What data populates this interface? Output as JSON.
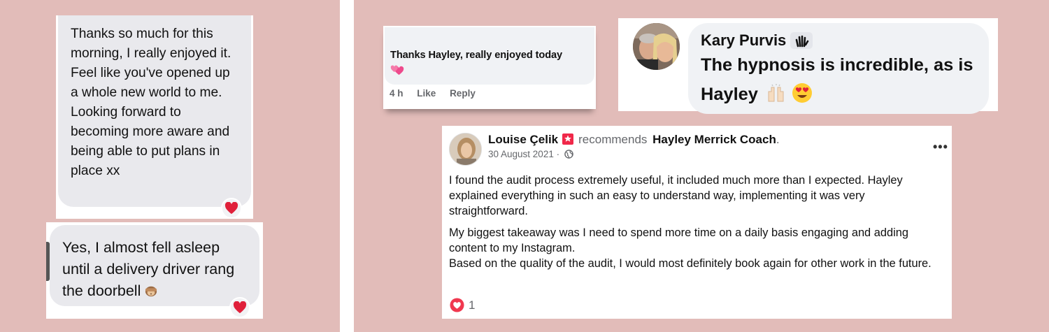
{
  "imessage_1": {
    "text": "Thanks so much for this morning, I really enjoyed it. Feel like you've opened up a whole new world to me. Looking forward to becoming more aware and being able to put plans in place xx",
    "reaction_icon": "heart-icon"
  },
  "imessage_2": {
    "text": "Yes, I almost fell asleep until a delivery driver rang the doorbell",
    "emoji_icon": "see-no-evil-monkey-icon",
    "reaction_icon": "heart-icon"
  },
  "fb_comment": {
    "text": "Thanks Hayley, really enjoyed today",
    "emoji_icon": "two-hearts-icon",
    "time": "4 h",
    "like_label": "Like",
    "reply_label": "Reply"
  },
  "kary_comment": {
    "name": "Kary Purvis",
    "badge_icon": "waving-hand-icon",
    "line1": "The hypnosis is incredible, as is",
    "line2": "Hayley",
    "emoji_icons": [
      "raising-hands-icon",
      "heart-eyes-icon"
    ]
  },
  "review": {
    "author": "Louise Çelik",
    "author_badge_icon": "recommend-flag-icon",
    "verb": "recommends",
    "page_name": "Hayley Merrick Coach",
    "end_punct": ".",
    "date": "30 August 2021 ·",
    "audience_icon": "globe-icon",
    "menu_icon": "more-options-icon",
    "paragraph1": "I found the audit process extremely useful, it included much more than I expected. Hayley explained everything in such an easy to understand way, implementing it was very straightforward.",
    "paragraph2_line1": "My biggest takeaway was I need to spend more time on a daily basis engaging and adding content to my Instagram.",
    "paragraph2_line2": "Based on the quality of the audit, I would most definitely book again for other work in the future.",
    "reaction_icon": "love-reaction-icon",
    "reaction_count": "1"
  },
  "colors": {
    "background": "#e2bcb9",
    "imessage_bubble": "#e9e9ed",
    "fb_bubble": "#f0f2f5",
    "heart": "#e0203a",
    "love_reaction": "#f0384f",
    "meta_gray": "#65676b"
  }
}
